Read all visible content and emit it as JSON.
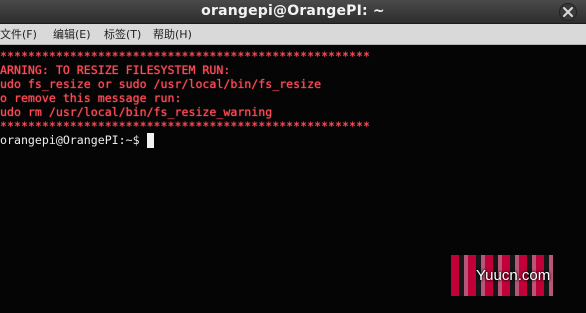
{
  "window": {
    "title": "orangepi@OrangePI: ~",
    "close_icon": "close-icon"
  },
  "menubar": {
    "items": [
      "文件(F)",
      "编辑(E)",
      "标签(T)",
      "帮助(H)"
    ]
  },
  "terminal": {
    "lines": [
      "*****************************************************",
      "ARNING: TO RESIZE FILESYSTEM RUN:",
      "udo fs_resize or sudo /usr/local/bin/fs_resize",
      "o remove this message run:",
      "udo rm /usr/local/bin/fs_resize_warning",
      "*****************************************************"
    ],
    "prompt": "orangepi@OrangePI:~$"
  },
  "watermark": {
    "text": "Yuucn.com"
  },
  "colors": {
    "terminal_background": "#050505",
    "warning_text": "#ff4b57",
    "prompt_text": "#ededed",
    "menubar_background": "#d9d9d9",
    "titlebar_background": "#3a3a3a"
  }
}
